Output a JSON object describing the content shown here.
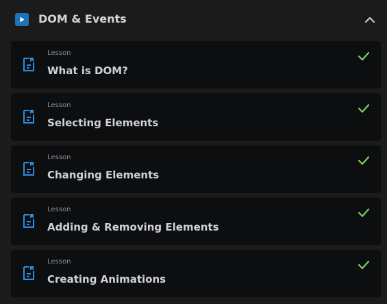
{
  "section": {
    "title": "DOM & Events",
    "icon": "play-icon",
    "toggle_icon": "chevron-up-icon",
    "accent_color": "#1c73b8"
  },
  "lessons": [
    {
      "type_label": "Lesson",
      "title": "What is DOM?",
      "status_icon": "check-icon"
    },
    {
      "type_label": "Lesson",
      "title": "Selecting Elements",
      "status_icon": "check-icon"
    },
    {
      "type_label": "Lesson",
      "title": "Changing Elements",
      "status_icon": "check-icon"
    },
    {
      "type_label": "Lesson",
      "title": "Adding & Removing Elements",
      "status_icon": "check-icon"
    },
    {
      "type_label": "Lesson",
      "title": "Creating Animations",
      "status_icon": "check-icon"
    }
  ],
  "colors": {
    "completed_check": "#7ed05a",
    "lesson_icon": "#2b8de0"
  }
}
